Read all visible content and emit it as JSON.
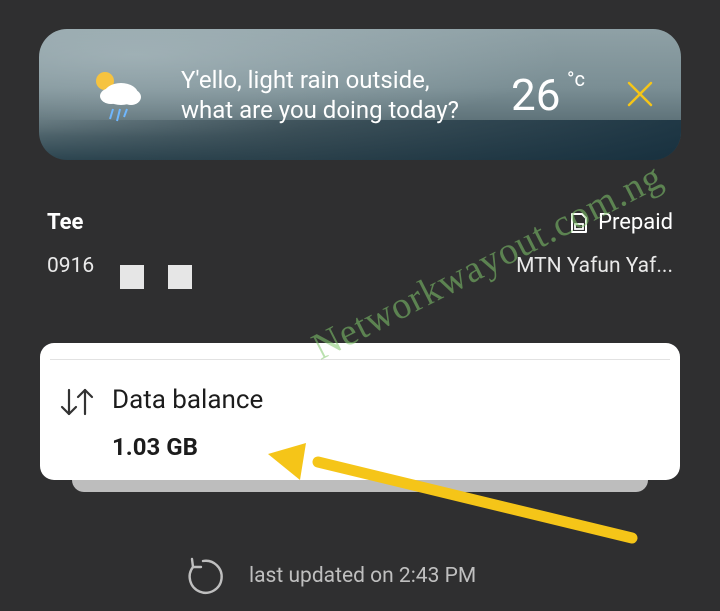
{
  "weather": {
    "greeting_line1": "Y'ello, light rain outside,",
    "greeting_line2": "what are you doing today?",
    "temperature": "26",
    "unit": "°c",
    "icon": "sun-cloud-rain-icon"
  },
  "account": {
    "name": "Tee",
    "number": "0916",
    "plan": "Prepaid",
    "plan_icon": "sim-card-icon",
    "network": "MTN Yafun Yaf..."
  },
  "balance": {
    "label": "Data balance",
    "value": "1.03 GB",
    "icon": "up-down-arrows-icon"
  },
  "footer": {
    "updated": "last updated on 2:43 PM",
    "icon": "refresh-icon"
  },
  "watermark": "Networkwayout.com.ng",
  "colors": {
    "background": "#2f2f30",
    "card": "#ffffff",
    "accent_close": "#f5c518",
    "annotation_arrow": "#f5c518",
    "watermark": "#82c86e"
  }
}
